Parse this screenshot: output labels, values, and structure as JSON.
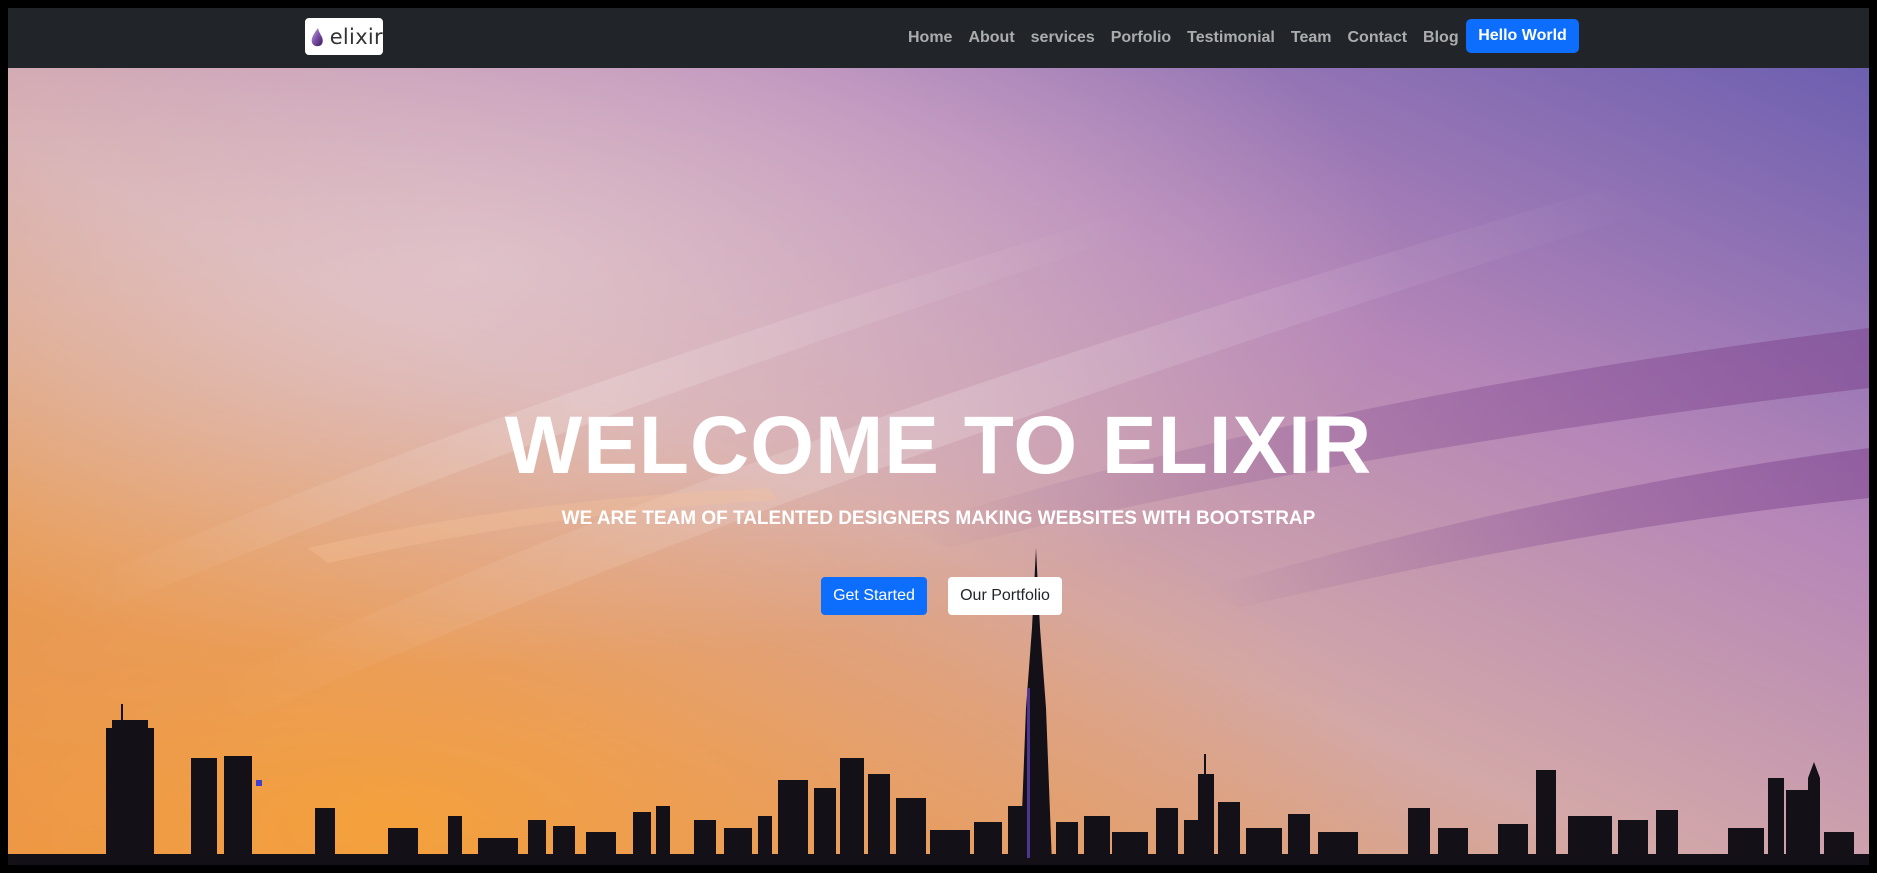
{
  "navbar": {
    "brand": {
      "text": "elixir",
      "icon": "elixir-drop-logo"
    },
    "links": [
      "Home",
      "About",
      "services",
      "Porfolio",
      "Testimonial",
      "Team",
      "Contact",
      "Blog"
    ],
    "cta_label": "Hello World",
    "cta_color": "#0d6efd"
  },
  "hero": {
    "title": "WELCOME TO ELIXIR",
    "subtitle": "WE ARE TEAM OF TALENTED DESIGNERS MAKING WEBSITES WITH BOOTSTRAP",
    "primary_button": "Get Started",
    "secondary_button": "Our Portfolio",
    "background": "sunset-city-skyline"
  }
}
